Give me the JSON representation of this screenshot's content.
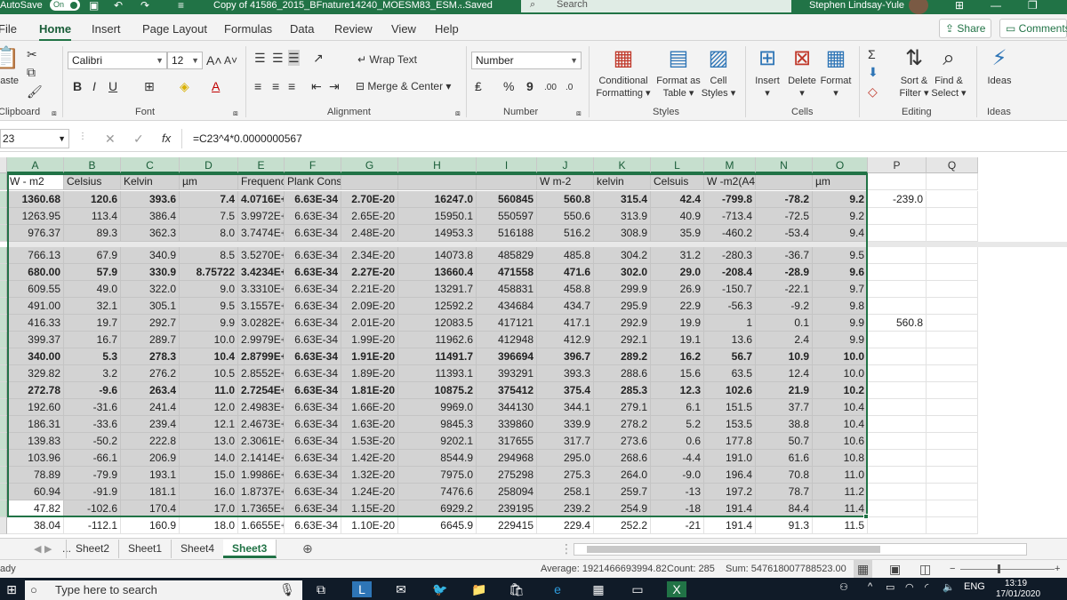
{
  "titlebar": {
    "autosave_label": "AutoSave",
    "autosave_state": "On",
    "filename": "Copy of 41586_2015_BFnature14240_MOESM83_ESM...",
    "saved_label": "- Saved",
    "search_placeholder": "Search",
    "user": "Stephen Lindsay-Yule"
  },
  "ribbon_tabs": [
    "File",
    "Home",
    "Insert",
    "Page Layout",
    "Formulas",
    "Data",
    "Review",
    "View",
    "Help"
  ],
  "share_label": "Share",
  "comments_label": "Comments",
  "ribbon": {
    "clipboard": {
      "paste": "Paste",
      "group": "Clipboard"
    },
    "font": {
      "name": "Calibri",
      "size": "12",
      "bold": "B",
      "italic": "I",
      "underline": "U",
      "group": "Font"
    },
    "alignment": {
      "wrap": "Wrap Text",
      "merge": "Merge & Center",
      "group": "Alignment"
    },
    "number": {
      "format": "Number",
      "group": "Number",
      "percent": "%",
      "comma": "9",
      "inc": ".00",
      "dec": ".0"
    },
    "styles": {
      "conditional": [
        "Conditional",
        "Formatting"
      ],
      "format_table": [
        "Format as",
        "Table"
      ],
      "cell_styles": [
        "Cell",
        "Styles"
      ],
      "group": "Styles"
    },
    "cells": {
      "insert": "Insert",
      "delete": "Delete",
      "format": "Format",
      "group": "Cells"
    },
    "editing": {
      "sort": [
        "Sort &",
        "Filter"
      ],
      "find": [
        "Find &",
        "Select"
      ],
      "group": "Editing"
    },
    "ideas": {
      "label": "Ideas",
      "group": "Ideas"
    }
  },
  "formula_bar": {
    "name_box": "23",
    "fx": "fx",
    "formula": "=C23^4*0.0000000567"
  },
  "columns": [
    "A",
    "B",
    "C",
    "D",
    "E",
    "F",
    "G",
    "H",
    "I",
    "J",
    "K",
    "L",
    "M",
    "N",
    "O",
    "P",
    "Q"
  ],
  "header_row": [
    "W - m2",
    "Celsius",
    "Kelvin",
    "µm",
    "Frequency(Hz)",
    "Plank Const",
    "",
    "",
    "",
    "W m-2",
    "kelvin",
    "Celsuis",
    "W -m2(A4-J4)",
    "",
    "µm",
    "",
    ""
  ],
  "rows": [
    [
      "1360.68",
      "120.6",
      "393.6",
      "7.4",
      "4.0716E+13",
      "6.63E-34",
      "2.70E-20",
      "16247.0",
      "560845",
      "560.8",
      "315.4",
      "42.4",
      "-799.8",
      "-78.2",
      "9.2",
      "-239.0",
      ""
    ],
    [
      "1263.95",
      "113.4",
      "386.4",
      "7.5",
      "3.9972E+13",
      "6.63E-34",
      "2.65E-20",
      "15950.1",
      "550597",
      "550.6",
      "313.9",
      "40.9",
      "-713.4",
      "-72.5",
      "9.2",
      "",
      ""
    ],
    [
      "976.37",
      "89.3",
      "362.3",
      "8.0",
      "3.7474E+13",
      "6.63E-34",
      "2.48E-20",
      "14953.3",
      "516188",
      "516.2",
      "308.9",
      "35.9",
      "-460.2",
      "-53.4",
      "9.4",
      "",
      ""
    ],
    [
      "766.13",
      "67.9",
      "340.9",
      "8.5",
      "3.5270E+13",
      "6.63E-34",
      "2.34E-20",
      "14073.8",
      "485829",
      "485.8",
      "304.2",
      "31.2",
      "-280.3",
      "-36.7",
      "9.5",
      "",
      ""
    ],
    [
      "680.00",
      "57.9",
      "330.9",
      "8.75722",
      "3.4234E+13",
      "6.63E-34",
      "2.27E-20",
      "13660.4",
      "471558",
      "471.6",
      "302.0",
      "29.0",
      "-208.4",
      "-28.9",
      "9.6",
      "",
      ""
    ],
    [
      "609.55",
      "49.0",
      "322.0",
      "9.0",
      "3.3310E+13",
      "6.63E-34",
      "2.21E-20",
      "13291.7",
      "458831",
      "458.8",
      "299.9",
      "26.9",
      "-150.7",
      "-22.1",
      "9.7",
      "",
      ""
    ],
    [
      "491.00",
      "32.1",
      "305.1",
      "9.5",
      "3.1557E+13",
      "6.63E-34",
      "2.09E-20",
      "12592.2",
      "434684",
      "434.7",
      "295.9",
      "22.9",
      "-56.3",
      "-9.2",
      "9.8",
      "",
      ""
    ],
    [
      "416.33",
      "19.7",
      "292.7",
      "9.9",
      "3.0282E+13",
      "6.63E-34",
      "2.01E-20",
      "12083.5",
      "417121",
      "417.1",
      "292.9",
      "19.9",
      "1",
      "0.1",
      "9.9",
      "560.8",
      ""
    ],
    [
      "399.37",
      "16.7",
      "289.7",
      "10.0",
      "2.9979E+13",
      "6.63E-34",
      "1.99E-20",
      "11962.6",
      "412948",
      "412.9",
      "292.1",
      "19.1",
      "13.6",
      "2.4",
      "9.9",
      "",
      ""
    ],
    [
      "340.00",
      "5.3",
      "278.3",
      "10.4",
      "2.8799E+13",
      "6.63E-34",
      "1.91E-20",
      "11491.7",
      "396694",
      "396.7",
      "289.2",
      "16.2",
      "56.7",
      "10.9",
      "10.0",
      "",
      ""
    ],
    [
      "329.82",
      "3.2",
      "276.2",
      "10.5",
      "2.8552E+13",
      "6.63E-34",
      "1.89E-20",
      "11393.1",
      "393291",
      "393.3",
      "288.6",
      "15.6",
      "63.5",
      "12.4",
      "10.0",
      "",
      ""
    ],
    [
      "272.78",
      "-9.6",
      "263.4",
      "11.0",
      "2.7254E+13",
      "6.63E-34",
      "1.81E-20",
      "10875.2",
      "375412",
      "375.4",
      "285.3",
      "12.3",
      "102.6",
      "21.9",
      "10.2",
      "",
      ""
    ],
    [
      "192.60",
      "-31.6",
      "241.4",
      "12.0",
      "2.4983E+13",
      "6.63E-34",
      "1.66E-20",
      "9969.0",
      "344130",
      "344.1",
      "279.1",
      "6.1",
      "151.5",
      "37.7",
      "10.4",
      "",
      ""
    ],
    [
      "186.31",
      "-33.6",
      "239.4",
      "12.1",
      "2.4673E+13",
      "6.63E-34",
      "1.63E-20",
      "9845.3",
      "339860",
      "339.9",
      "278.2",
      "5.2",
      "153.5",
      "38.8",
      "10.4",
      "",
      ""
    ],
    [
      "139.83",
      "-50.2",
      "222.8",
      "13.0",
      "2.3061E+13",
      "6.63E-34",
      "1.53E-20",
      "9202.1",
      "317655",
      "317.7",
      "273.6",
      "0.6",
      "177.8",
      "50.7",
      "10.6",
      "",
      ""
    ],
    [
      "103.96",
      "-66.1",
      "206.9",
      "14.0",
      "2.1414E+13",
      "6.63E-34",
      "1.42E-20",
      "8544.9",
      "294968",
      "295.0",
      "268.6",
      "-4.4",
      "191.0",
      "61.6",
      "10.8",
      "",
      ""
    ],
    [
      "78.89",
      "-79.9",
      "193.1",
      "15.0",
      "1.9986E+13",
      "6.63E-34",
      "1.32E-20",
      "7975.0",
      "275298",
      "275.3",
      "264.0",
      "-9.0",
      "196.4",
      "70.8",
      "11.0",
      "",
      ""
    ],
    [
      "60.94",
      "-91.9",
      "181.1",
      "16.0",
      "1.8737E+13",
      "6.63E-34",
      "1.24E-20",
      "7476.6",
      "258094",
      "258.1",
      "259.7",
      "-13",
      "197.2",
      "78.7",
      "11.2",
      "",
      ""
    ],
    [
      "47.82",
      "-102.6",
      "170.4",
      "17.0",
      "1.7365E+13",
      "6.63E-34",
      "1.15E-20",
      "6929.2",
      "239195",
      "239.2",
      "254.9",
      "-18",
      "191.4",
      "84.4",
      "11.4",
      "",
      ""
    ],
    [
      "38.04",
      "-112.1",
      "160.9",
      "18.0",
      "1.6655E+13",
      "6.63E-34",
      "1.10E-20",
      "6645.9",
      "229415",
      "229.4",
      "252.2",
      "-21",
      "191.4",
      "91.3",
      "11.5",
      "",
      ""
    ]
  ],
  "sheet_tabs": [
    "...",
    "Sheet2",
    "Sheet1",
    "Sheet4",
    "Sheet3"
  ],
  "active_sheet": "Sheet3",
  "status": {
    "mode": "ady",
    "average": "Average: 1921466693994.82",
    "count": "Count: 285",
    "sum": "Sum: 547618007788523.00"
  },
  "taskbar": {
    "search_placeholder": "Type here to search",
    "lang": "ENG",
    "time": "13:19",
    "date": "17/01/2020"
  }
}
